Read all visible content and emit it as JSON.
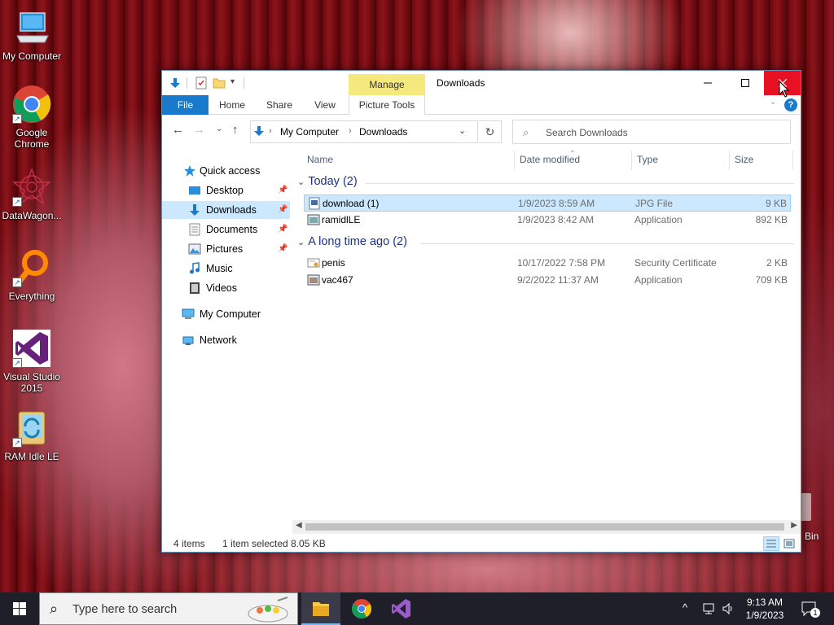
{
  "desktop": {
    "icons": [
      {
        "label": "My Computer",
        "icon": "computer-icon"
      },
      {
        "label": "Google Chrome",
        "icon": "chrome-icon"
      },
      {
        "label": "DataWagon...",
        "icon": "datawagon-icon"
      },
      {
        "label": "Everything",
        "icon": "everything-search-icon"
      },
      {
        "label": "Visual Studio 2015",
        "icon": "visual-studio-icon"
      },
      {
        "label": "RAM Idle LE",
        "icon": "ram-idle-icon"
      }
    ],
    "recycle_bin_label": "Bin"
  },
  "window": {
    "title": "Downloads",
    "contextual_tab_group": "Manage",
    "ribbon_tabs": [
      "File",
      "Home",
      "Share",
      "View",
      "Picture Tools"
    ],
    "help_label": "?",
    "address": {
      "crumbs": [
        "My Computer",
        "Downloads"
      ]
    },
    "search": {
      "placeholder": "Search Downloads"
    },
    "nav_pane": {
      "quick_access": "Quick access",
      "items": [
        {
          "label": "Desktop",
          "pinned": true,
          "icon": "desktop-folder-icon"
        },
        {
          "label": "Downloads",
          "pinned": true,
          "selected": true,
          "icon": "downloads-folder-icon"
        },
        {
          "label": "Documents",
          "pinned": true,
          "icon": "documents-folder-icon"
        },
        {
          "label": "Pictures",
          "pinned": true,
          "icon": "pictures-folder-icon"
        },
        {
          "label": "Music",
          "pinned": false,
          "icon": "music-folder-icon"
        },
        {
          "label": "Videos",
          "pinned": false,
          "icon": "videos-folder-icon"
        }
      ],
      "my_computer": "My Computer",
      "network": "Network"
    },
    "columns": {
      "name": "Name",
      "date": "Date modified",
      "type": "Type",
      "size": "Size"
    },
    "groups": [
      {
        "title": "Today (2)",
        "files": [
          {
            "name": "download (1)",
            "date": "1/9/2023 8:59 AM",
            "type": "JPG File",
            "size": "9 KB",
            "selected": true,
            "icon": "jpg-file-icon"
          },
          {
            "name": "ramidlLE",
            "date": "1/9/2023 8:42 AM",
            "type": "Application",
            "size": "892 KB",
            "selected": false,
            "icon": "application-icon"
          }
        ]
      },
      {
        "title": "A long time ago (2)",
        "files": [
          {
            "name": "penis",
            "date": "10/17/2022 7:58 PM",
            "type": "Security Certificate",
            "size": "2 KB",
            "selected": false,
            "icon": "certificate-icon"
          },
          {
            "name": "vac467",
            "date": "9/2/2022 11:37 AM",
            "type": "Application",
            "size": "709 KB",
            "selected": false,
            "icon": "application-icon"
          }
        ]
      }
    ],
    "status": {
      "items": "4 items",
      "selected": "1 item selected",
      "size": "8.05 KB"
    }
  },
  "taskbar": {
    "search_placeholder": "Type here to search",
    "clock_time": "9:13 AM",
    "clock_date": "1/9/2023",
    "notification_count": "1"
  },
  "colors": {
    "accent": "#1979ca",
    "selection": "#cce8ff",
    "close": "#e81123",
    "manage_tab": "#f5e87d"
  }
}
